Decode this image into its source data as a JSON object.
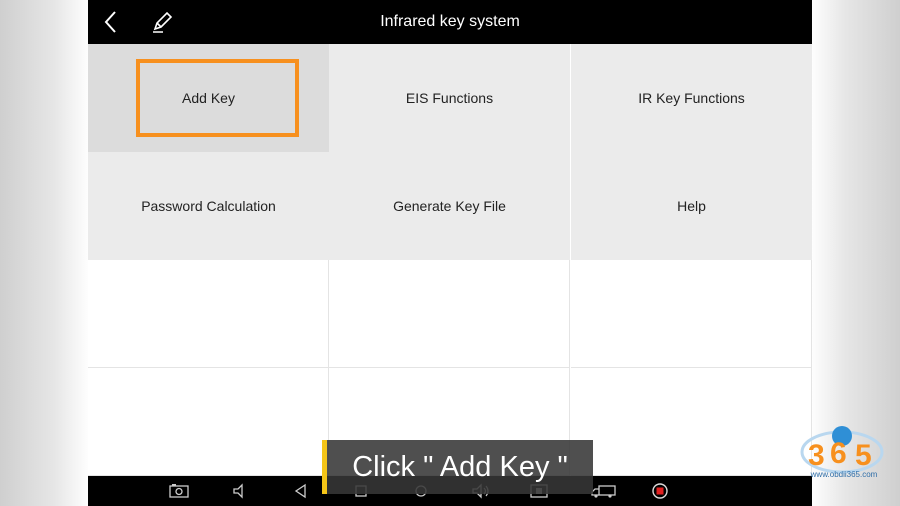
{
  "header": {
    "title": "Infrared key system"
  },
  "menu": {
    "items": [
      {
        "label": "Add Key",
        "selected": true
      },
      {
        "label": "EIS Functions"
      },
      {
        "label": "IR Key Functions"
      },
      {
        "label": "Password Calculation"
      },
      {
        "label": "Generate Key File"
      },
      {
        "label": "Help"
      }
    ]
  },
  "caption": {
    "text": "Click \" Add Key \""
  },
  "watermark": {
    "logo": "365",
    "url": "www.obdii365.com"
  },
  "icons": {
    "back": "chevron-left-icon",
    "edit": "pencil-icon",
    "nav": [
      "camera-icon",
      "volume-down-icon",
      "back-triangle-icon",
      "recent-apps-icon",
      "home-circle-icon",
      "volume-up-icon",
      "screenshot-icon",
      "truck-icon",
      "record-icon"
    ]
  },
  "colors": {
    "highlight": "#f7901e",
    "caption_bar": "#f5c518",
    "record": "#e02020"
  }
}
